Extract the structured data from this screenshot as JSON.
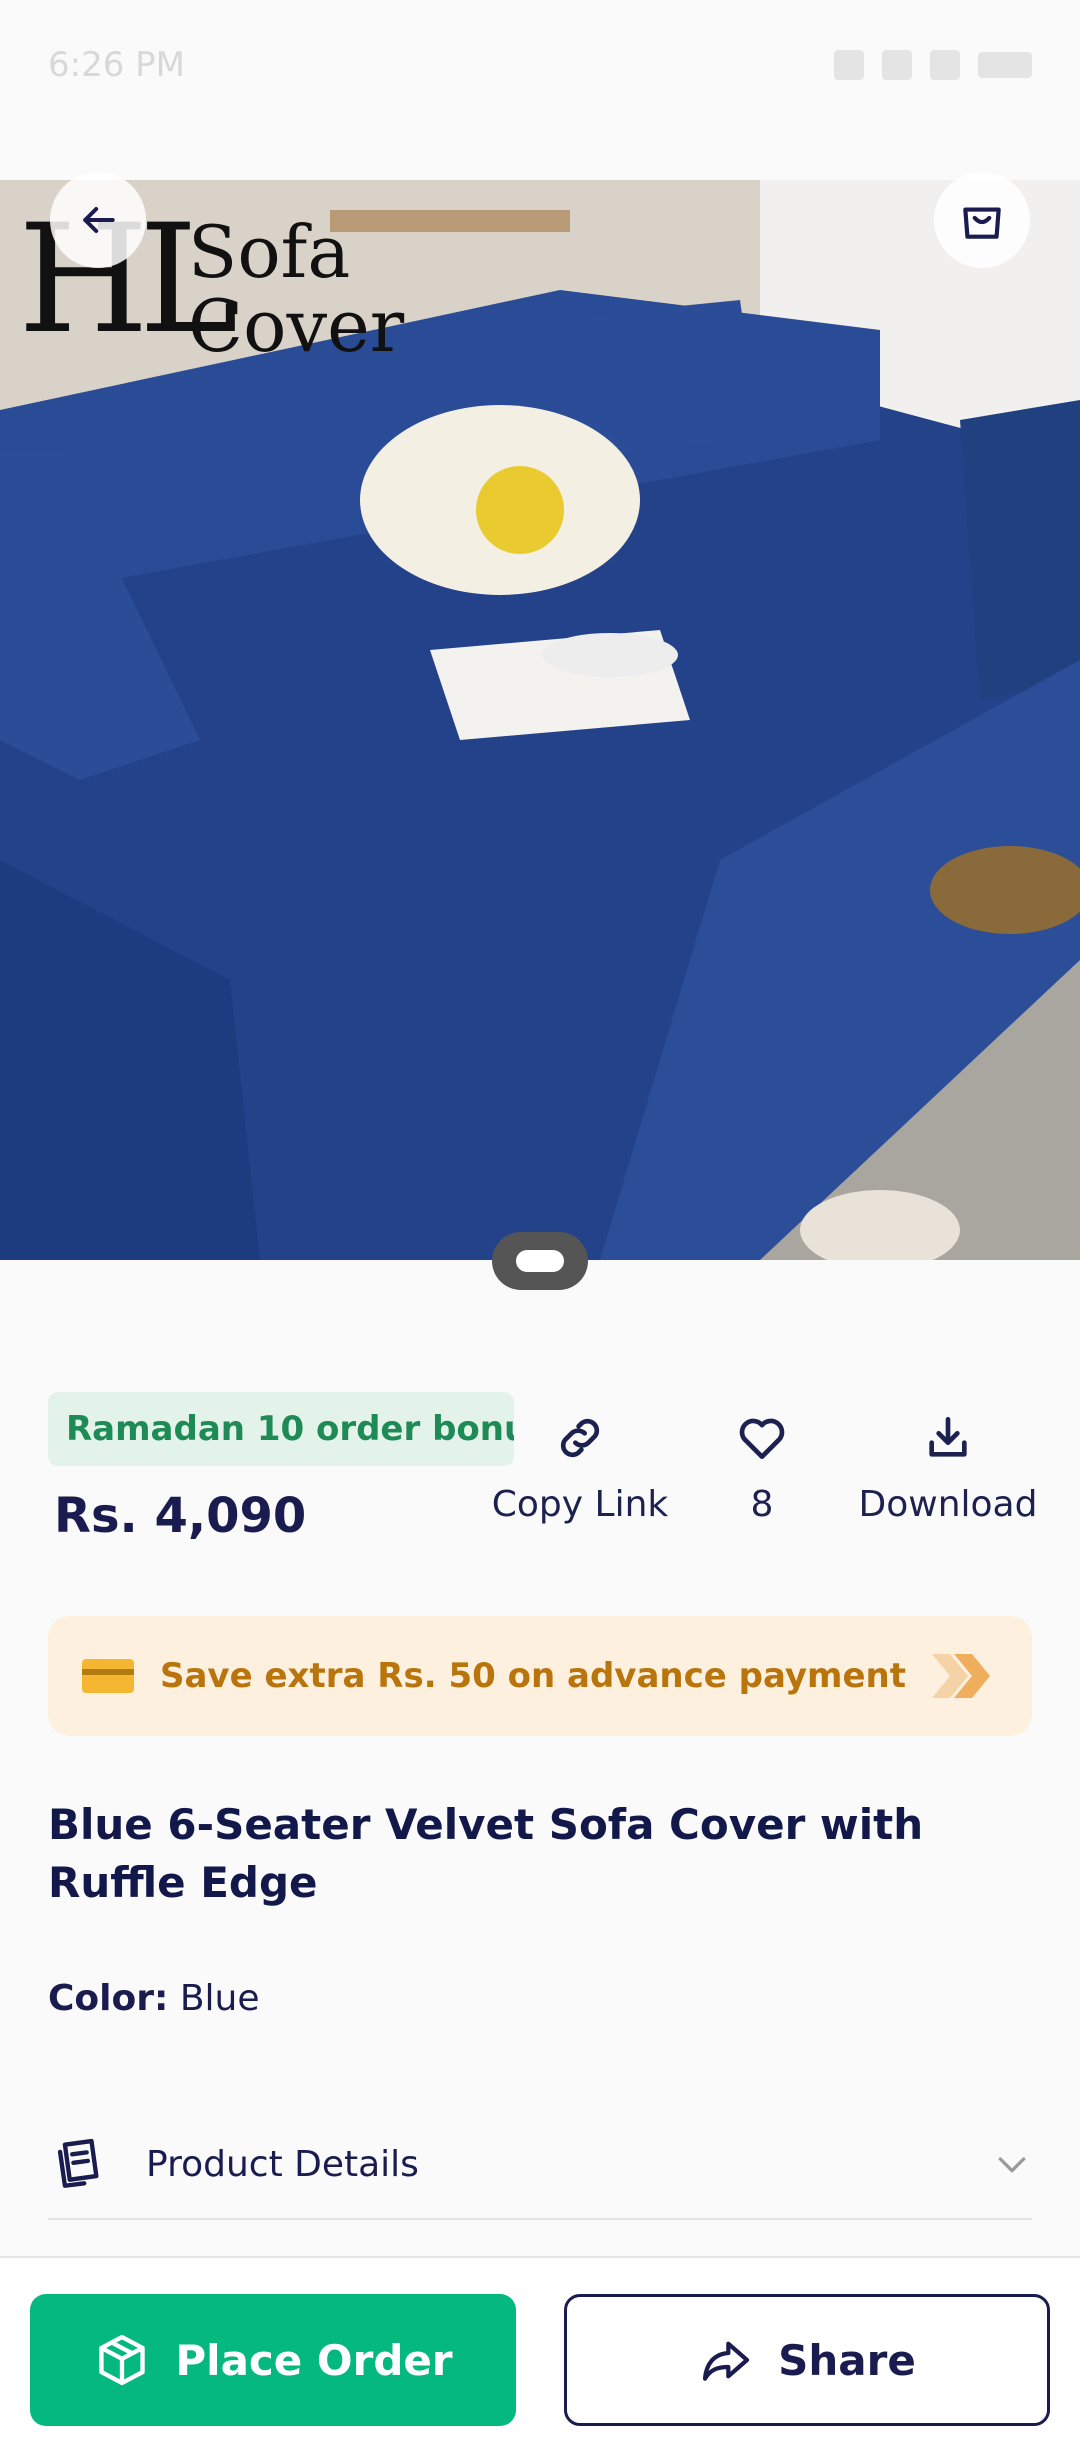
{
  "status_bar": {
    "time": "6:26 PM"
  },
  "hero": {
    "logo_big": "HL",
    "logo_line1": "Sofa",
    "logo_line2": "Cover"
  },
  "promo": {
    "chip_text": "Ramadan 10 order bonu...",
    "price": "Rs. 4,090"
  },
  "actions": {
    "copy_link": "Copy Link",
    "likes": "8",
    "download": "Download"
  },
  "save_banner": {
    "text": "Save extra Rs. 50 on advance payment"
  },
  "product": {
    "title": "Blue 6-Seater Velvet Sofa Cover with Ruffle Edge",
    "color_label": "Color:",
    "color_value": "Blue",
    "details_label": "Product Details"
  },
  "bottom": {
    "order_label": "Place Order",
    "share_label": "Share"
  },
  "colors": {
    "primary": "#05b97e",
    "navy": "#1a1c4f",
    "promo_green": "#1e8a55",
    "save_orange": "#b9740c",
    "sofa_blue": "#23428a"
  },
  "icons": [
    "back-arrow-icon",
    "shopping-bag-icon",
    "link-icon",
    "heart-icon",
    "download-icon",
    "card-icon",
    "double-chevron-icon",
    "document-icon",
    "chevron-down-icon",
    "box-icon",
    "share-icon"
  ]
}
